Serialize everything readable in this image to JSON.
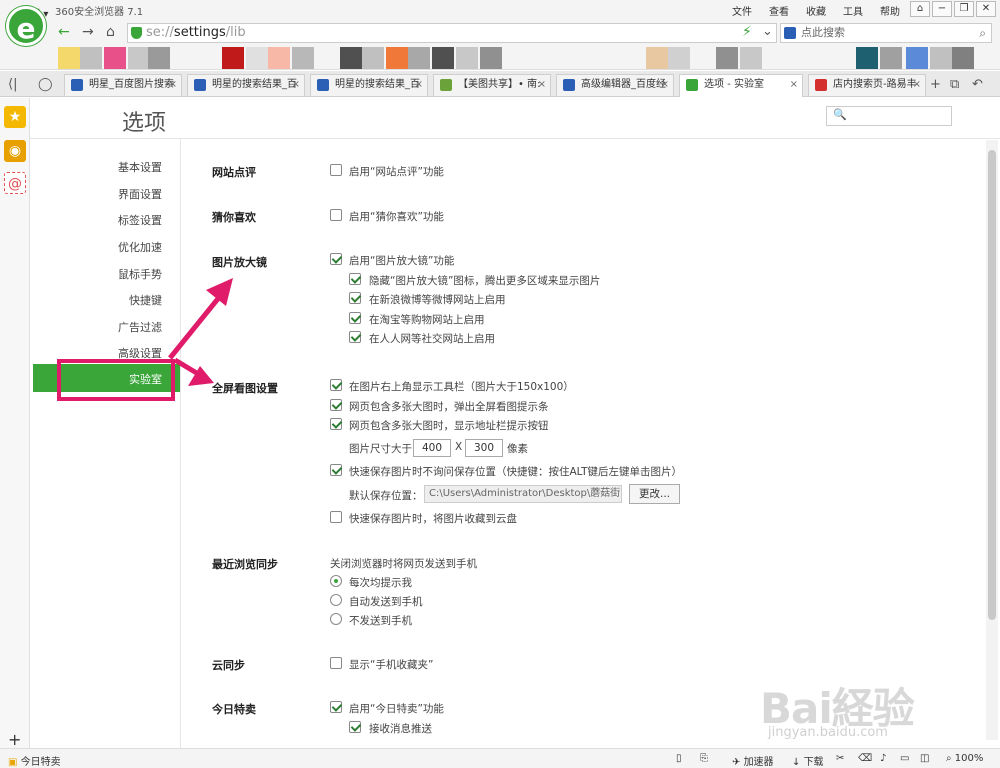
{
  "window": {
    "app_title": "360安全浏览器 7.1",
    "menu": [
      "文件",
      "查看",
      "收藏",
      "工具",
      "帮助"
    ],
    "win_buttons": [
      "⌂",
      "−",
      "❐",
      "✕"
    ]
  },
  "address_bar": {
    "url_scheme": "se://",
    "url_path": "settings",
    "url_lib": "/lib",
    "search_placeholder": "点此搜索"
  },
  "favorites": {
    "label": "收藏"
  },
  "tabs": [
    {
      "label": "明星_百度图片搜索",
      "color": "#2b5eb5"
    },
    {
      "label": "明星的搜索结果_百",
      "color": "#2b5eb5"
    },
    {
      "label": "明星的搜索结果_百",
      "color": "#2b5eb5"
    },
    {
      "label": "【美图共享】• 南:",
      "color": "#6ba33a"
    },
    {
      "label": "高级编辑器_百度经",
      "color": "#2b5eb5"
    },
    {
      "label": "选项 - 实验室",
      "color": "#3aa63a"
    },
    {
      "label": "店内搜索页-路易丰",
      "color": "#d32f2f"
    }
  ],
  "page": {
    "title": "选项",
    "search_placeholder": "🔍"
  },
  "nav": {
    "items": [
      "基本设置",
      "界面设置",
      "标签设置",
      "优化加速",
      "鼠标手势",
      "快捷键",
      "广告过滤",
      "高级设置"
    ],
    "active": "实验室"
  },
  "sections": {
    "site_review": {
      "title": "网站点评",
      "option": "启用“网站点评”功能",
      "checked": false
    },
    "guess": {
      "title": "猜你喜欢",
      "option": "启用“猜你喜欢”功能",
      "checked": false
    },
    "magnifier": {
      "title": "图片放大镜",
      "main": "启用“图片放大镜”功能",
      "sub": [
        "隐藏“图片放大镜”图标，腾出更多区域来显示图片",
        "在新浪微博等微博网站上启用",
        "在淘宝等购物网站上启用",
        "在人人网等社交网站上启用"
      ]
    },
    "fullscreen": {
      "title": "全屏看图设置",
      "opts": [
        "在图片右上角显示工具栏（图片大于150x100）",
        "网页包含多张大图时，弹出全屏看图提示条",
        "网页包含多张大图时，显示地址栏提示按钮"
      ],
      "size_label": "图片尺寸大于",
      "width": "400",
      "x": "X",
      "height": "300",
      "unit": "像素",
      "quick_save": "快速保存图片时不询问保存位置（快捷键：按住ALT键后左键单击图片）",
      "default_path_label": "默认保存位置：",
      "default_path": "C:\\Users\\Administrator\\Desktop\\蘑菇街",
      "change_button": "更改...",
      "cloud_save": "快速保存图片时，将图片收藏到云盘"
    },
    "sync": {
      "title": "最近浏览同步",
      "desc": "关闭浏览器时将网页发送到手机",
      "radios": [
        "每次均提示我",
        "自动发送到手机",
        "不发送到手机"
      ]
    },
    "cloud": {
      "title": "云同步",
      "option": "显示“手机收藏夹”"
    },
    "deals": {
      "title": "今日特卖",
      "option": "启用“今日特卖”功能",
      "sub": "接收消息推送"
    }
  },
  "status": {
    "left": "今日特卖",
    "accelerator": "加速器",
    "download": "下载",
    "zoom": "100%"
  },
  "watermark": {
    "text": "Bai経验",
    "url": "jingyan.baidu.com"
  },
  "colors": {
    "accent": "#3aa63a",
    "highlight": "#e01b6a"
  }
}
